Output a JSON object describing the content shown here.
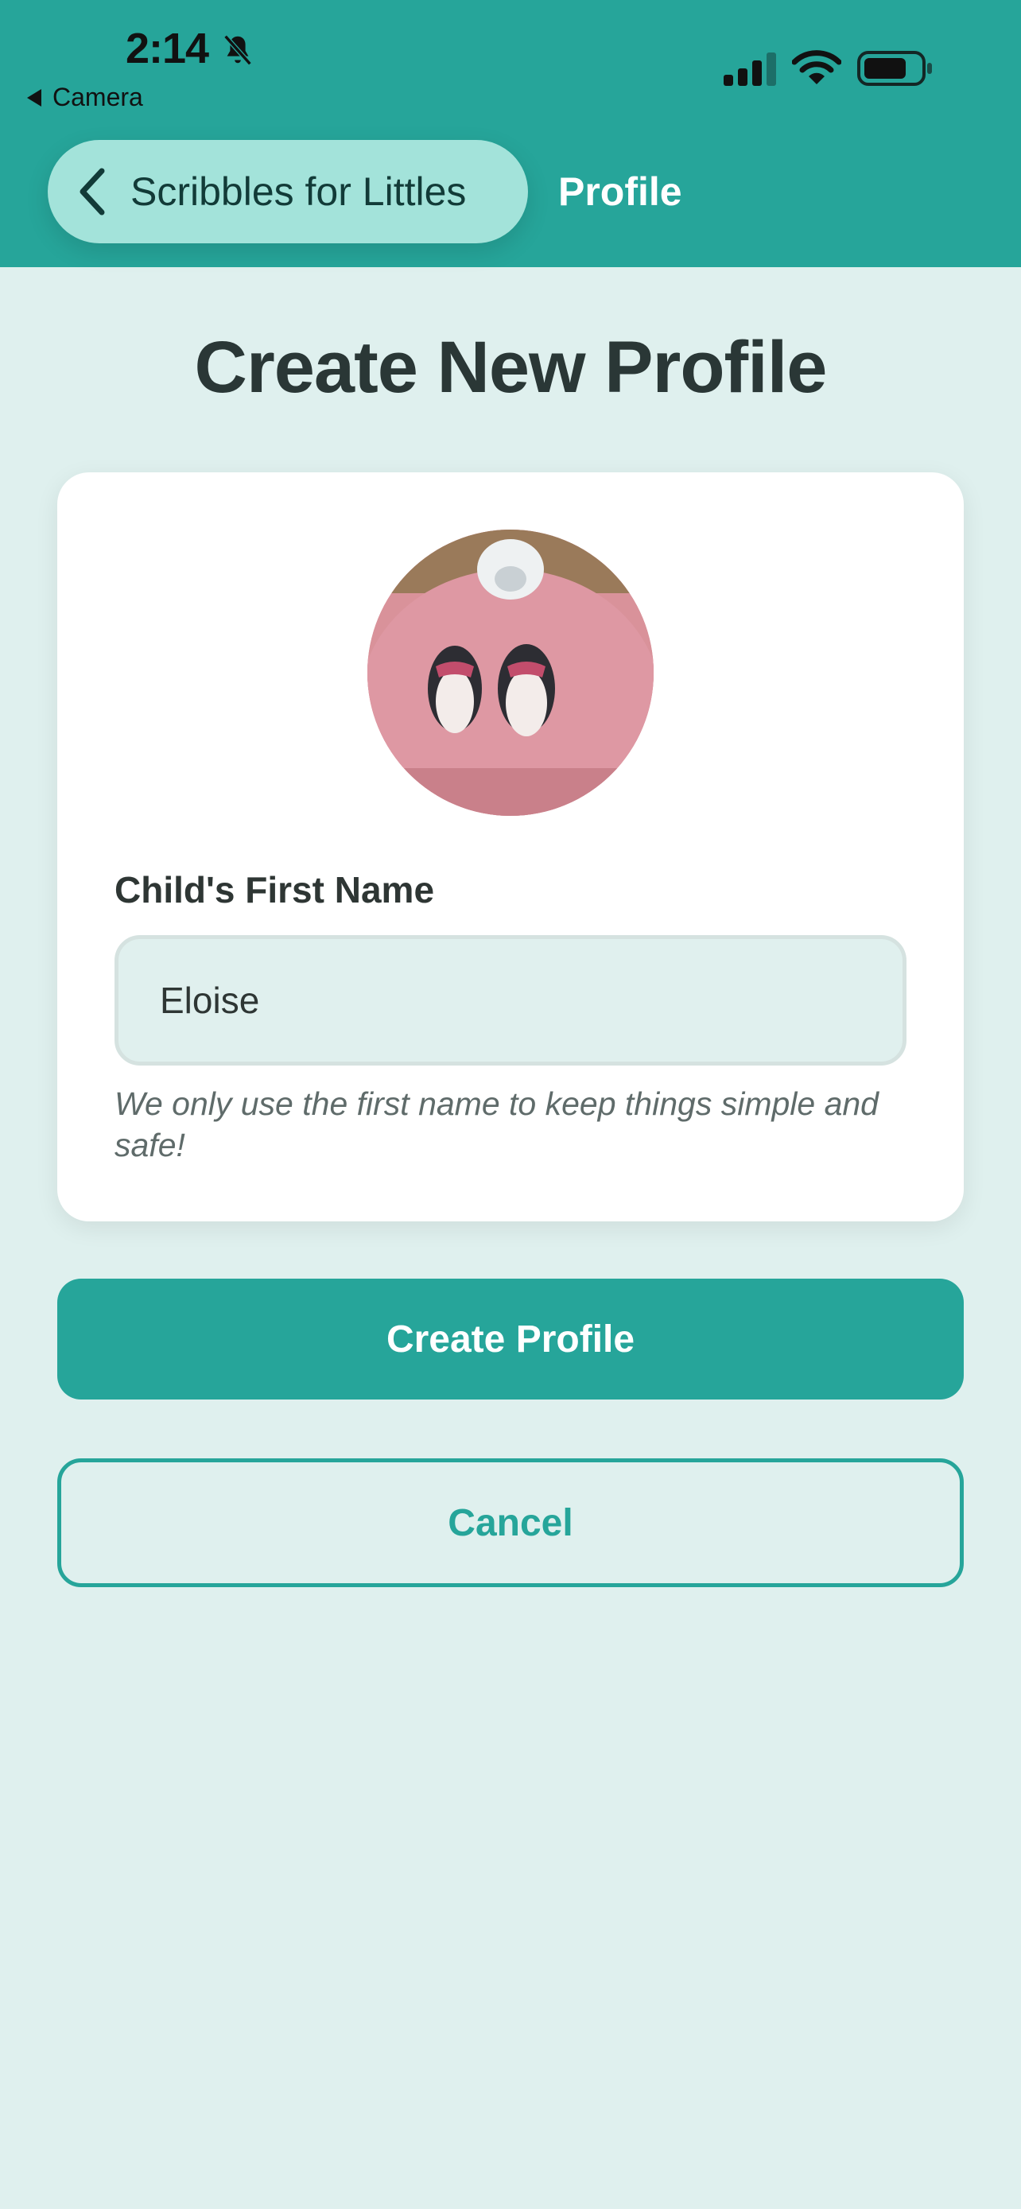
{
  "status_bar": {
    "time": "2:14",
    "back_app": "Camera"
  },
  "nav": {
    "back_label": "Scribbles for Littles",
    "title": "Profile"
  },
  "page": {
    "title": "Create New Profile"
  },
  "form": {
    "name_label": "Child's First Name",
    "name_value": "Eloise",
    "helper_text": "We only use the first name to keep things simple and safe!"
  },
  "actions": {
    "create_label": "Create Profile",
    "cancel_label": "Cancel"
  },
  "icons": {
    "bell": "bell-slash-icon",
    "signal": "cellular-signal-icon",
    "wifi": "wifi-icon",
    "battery": "battery-icon",
    "back": "chevron-left-icon"
  },
  "colors": {
    "primary": "#26a59a",
    "background": "#dff0ee",
    "pill": "#a3e3da"
  }
}
